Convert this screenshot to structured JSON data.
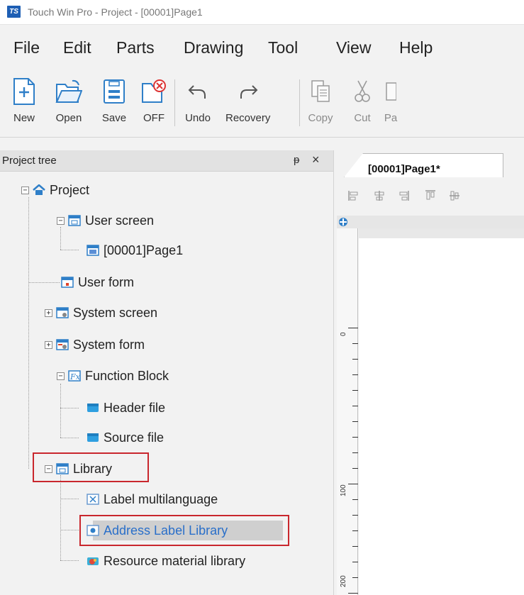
{
  "window": {
    "title": "Touch Win Pro - Project - [00001]Page1",
    "logo_text": "TS"
  },
  "menu": [
    "File",
    "Edit",
    "Parts",
    "Drawing",
    "Tool",
    "View",
    "Help"
  ],
  "toolbar": {
    "new": "New",
    "open": "Open",
    "save": "Save",
    "off": "OFF",
    "undo": "Undo",
    "recovery": "Recovery",
    "copy": "Copy",
    "cut": "Cut",
    "paste_partial": "Pa"
  },
  "panel": {
    "title": "Project tree",
    "pin_glyph": "ᵽ",
    "close_glyph": "×"
  },
  "tree": {
    "project": "Project",
    "user_screen": "User screen",
    "page1": "[00001]Page1",
    "user_form": "User form",
    "system_screen": "System screen",
    "system_form": "System form",
    "function_block": "Function Block",
    "header_file": "Header file",
    "source_file": "Source file",
    "library": "Library",
    "label_multilanguage": "Label multilanguage",
    "address_label_library": "Address Label Library",
    "resource_material_library": "Resource material library"
  },
  "editor": {
    "tab_label": "[00001]Page1*",
    "ruler_numbers": [
      "0",
      "100",
      "200"
    ]
  },
  "colors": {
    "highlight": "#c9272d",
    "accent_blue": "#1e5fb4",
    "selected_text": "#2a6fc9"
  }
}
